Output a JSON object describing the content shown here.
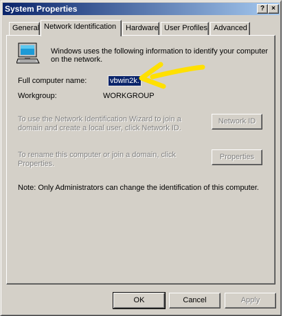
{
  "window": {
    "title": "System Properties",
    "help_button": "?",
    "close_button": "×"
  },
  "tabs": [
    {
      "label": "General",
      "active": false
    },
    {
      "label": "Network Identification",
      "active": true
    },
    {
      "label": "Hardware",
      "active": false
    },
    {
      "label": "User Profiles",
      "active": false
    },
    {
      "label": "Advanced",
      "active": false
    }
  ],
  "panel": {
    "intro": [
      "Windows uses the following information to identify your computer",
      "on the network."
    ],
    "full_name_label": "Full computer name:",
    "full_name_value": "vbwin2k.",
    "workgroup_label": "Workgroup:",
    "workgroup_value": "WORKGROUP",
    "wizard_text": [
      "To use the Network Identification Wizard to join a",
      "domain and create a local user, click Network ID."
    ],
    "network_id_button": "Network ID",
    "rename_text": [
      "To rename this computer or join a domain, click",
      "Properties."
    ],
    "properties_button": "Properties",
    "note": "Note: Only Administrators can change the identification of this computer."
  },
  "footer": {
    "ok": "OK",
    "cancel": "Cancel",
    "apply": "Apply"
  },
  "colors": {
    "dialog_face": "#d4d0c8",
    "title_start": "#0a246a",
    "title_end": "#a6caf0",
    "selection": "#0a246a",
    "annotation_arrow": "#ffe000"
  }
}
